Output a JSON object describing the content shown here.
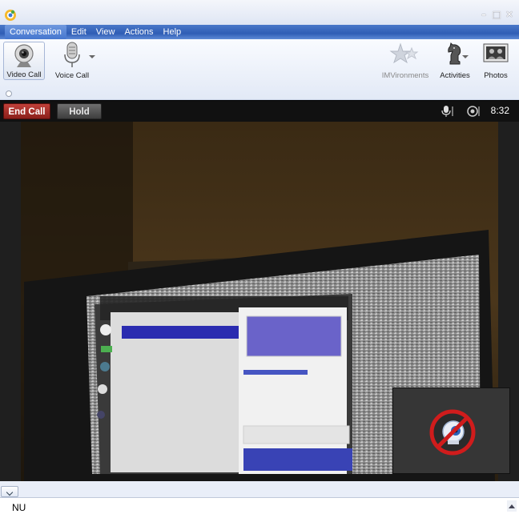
{
  "menubar": {
    "items": [
      "Conversation",
      "Edit",
      "View",
      "Actions",
      "Help"
    ]
  },
  "toolbar": {
    "video_call": "Video Call",
    "voice_call": "Voice Call",
    "imvironments": "IMVironments",
    "activities": "Activities",
    "photos": "Photos"
  },
  "callbar": {
    "end_call": "End Call",
    "hold": "Hold",
    "time": "8:32"
  },
  "chat": {
    "input_text": "NU"
  },
  "icons": {
    "app": "messenger-logo-icon",
    "webcam": "webcam-icon",
    "microphone": "microphone-icon",
    "imvironments": "stars-icon",
    "activities": "chess-knight-icon",
    "photos": "photos-icon",
    "mic_level": "mic-level-icon",
    "speaker": "speaker-icon",
    "webcam_blocked": "webcam-blocked-icon"
  },
  "colors": {
    "menubar": "#2f5db5",
    "end_call": "#a8302a",
    "video_bg": "#141414"
  }
}
